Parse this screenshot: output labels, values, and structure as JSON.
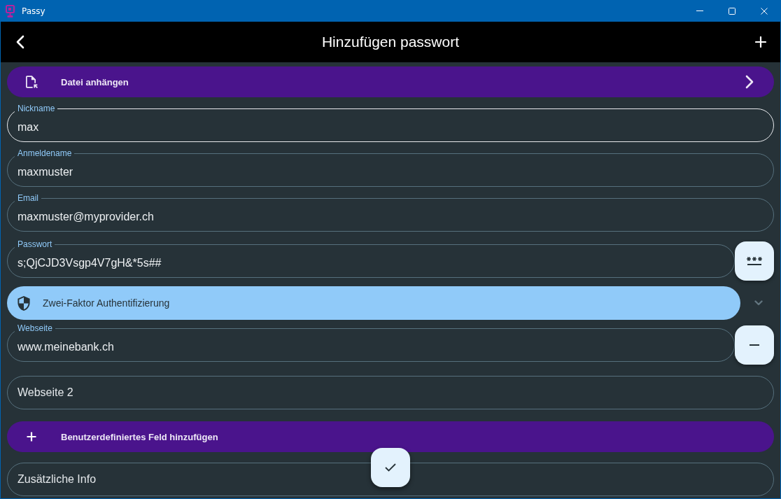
{
  "window": {
    "title": "Passy"
  },
  "app_bar": {
    "title": "Hinzufügen passwort"
  },
  "form": [
    {
      "kind": "attach",
      "label": "Datei anhängen"
    },
    {
      "kind": "field",
      "label": "Nickname",
      "value": "max",
      "focused": true
    },
    {
      "kind": "field",
      "label": "Anmeldename",
      "value": "maxmuster",
      "focused": false
    },
    {
      "kind": "field",
      "label": "Email",
      "value": "maxmuster@myprovider.ch",
      "focused": false
    },
    {
      "kind": "password_field",
      "label": "Passwort",
      "value": "s;QjCJD3Vsgp4V7gH&*5s##",
      "focused": false
    },
    {
      "kind": "expander",
      "label": "Zwei-Faktor Authentifizierung",
      "expanded": false
    },
    {
      "kind": "removable_field",
      "label": "Webseite",
      "value": "www.meinebank.ch",
      "focused": false
    },
    {
      "kind": "field",
      "placeholder": "Webseite 2",
      "focused": false
    },
    {
      "kind": "add",
      "label": "Benutzerdefiniertes Feld hinzufügen"
    },
    {
      "kind": "field",
      "placeholder": "Zusätzliche Info",
      "focused": false
    }
  ]
}
